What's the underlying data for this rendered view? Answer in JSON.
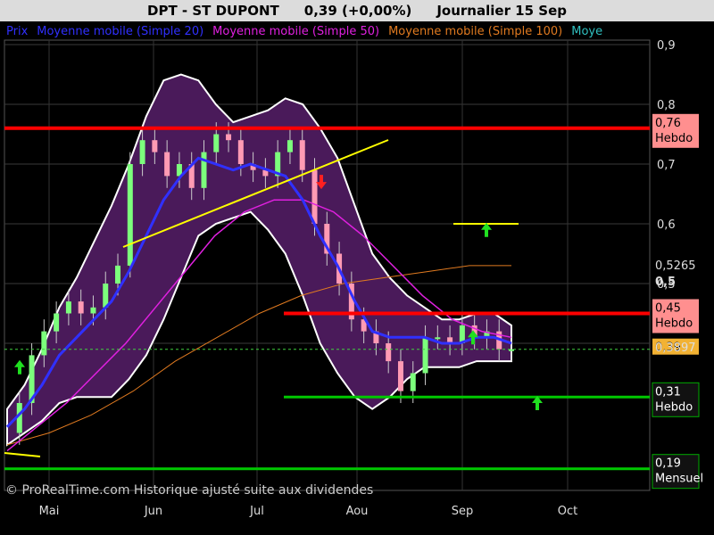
{
  "header": {
    "symbol": "DPT - ST DUPONT",
    "price_change": "0,39 (+0,00%)",
    "period": "Journalier  15 Sep"
  },
  "legend": [
    {
      "label": "Prix",
      "color": "#3030ff"
    },
    {
      "label": "Moyenne mobile (Simple 20)",
      "color": "#3030ff"
    },
    {
      "label": "Moyenne mobile (Simple 50)",
      "color": "#e020e0"
    },
    {
      "label": "Moyenne mobile (Simple 100)",
      "color": "#e07a20"
    },
    {
      "label": "Moye",
      "color": "#30c0c0"
    }
  ],
  "footer": "© ProRealTime.com Historique ajusté suite aux dividendes",
  "colors": {
    "background": "#000000",
    "bollinger_fill": "#4a1a5a",
    "candle_up": "#7cff7c",
    "candle_down": "#ff9ab4",
    "level_red": "#ff0000",
    "level_green": "#00c800",
    "trendline": "#ffff00"
  },
  "chart_data": {
    "type": "candlestick",
    "x_ticks": [
      "Mai",
      "Jun",
      "Jul",
      "Aou",
      "Sep",
      "Oct"
    ],
    "y_ticks": [
      0.4,
      0.5,
      0.6,
      0.7,
      0.8,
      0.9
    ],
    "y_tick_labels": [
      "0,4",
      "0,5",
      "0,6",
      "0,7",
      "0,8",
      "0,9"
    ],
    "ylim": [
      0.18,
      0.92
    ],
    "grid": true,
    "close_series": [
      0.25,
      0.3,
      0.38,
      0.42,
      0.45,
      0.47,
      0.45,
      0.46,
      0.5,
      0.53,
      0.7,
      0.74,
      0.72,
      0.68,
      0.7,
      0.66,
      0.72,
      0.75,
      0.74,
      0.7,
      0.69,
      0.68,
      0.72,
      0.74,
      0.69,
      0.6,
      0.55,
      0.5,
      0.44,
      0.42,
      0.4,
      0.37,
      0.32,
      0.35,
      0.41,
      0.41,
      0.4,
      0.43,
      0.41,
      0.42,
      0.39,
      0.39
    ],
    "sma20_series": [
      0.26,
      0.29,
      0.33,
      0.38,
      0.41,
      0.44,
      0.47,
      0.52,
      0.58,
      0.64,
      0.68,
      0.71,
      0.7,
      0.69,
      0.7,
      0.69,
      0.68,
      0.64,
      0.58,
      0.53,
      0.47,
      0.42,
      0.41,
      0.41,
      0.41,
      0.4,
      0.4,
      0.41,
      0.41,
      0.4
    ],
    "sma50_series": [
      0.22,
      0.26,
      0.3,
      0.35,
      0.4,
      0.46,
      0.52,
      0.58,
      0.62,
      0.64,
      0.64,
      0.62,
      0.58,
      0.53,
      0.48,
      0.44,
      0.42,
      0.41
    ],
    "sma100_series": [
      0.23,
      0.25,
      0.28,
      0.32,
      0.37,
      0.41,
      0.45,
      0.48,
      0.5,
      0.51,
      0.52,
      0.53,
      0.53
    ],
    "levels": [
      {
        "value": 0.76,
        "label": "0,76",
        "tag": "Hebdo",
        "color": "red"
      },
      {
        "value": 0.45,
        "label": "0,45",
        "tag": "Hebdo",
        "color": "red"
      },
      {
        "value": 0.31,
        "label": "0,31",
        "tag": "Hebdo",
        "color": "green"
      },
      {
        "value": 0.19,
        "label": "0,19",
        "tag": "Mensuel",
        "color": "green"
      }
    ],
    "side_values": [
      {
        "value": 0.5265,
        "label": "0,5265"
      },
      {
        "value": 0.5,
        "label": "0,5"
      },
      {
        "value": 0.39,
        "label": "0,39"
      },
      {
        "value": 0.3897,
        "label": "0,3897"
      }
    ],
    "arrows": [
      {
        "date_index": 0,
        "direction": "up",
        "color": "green"
      },
      {
        "date_index": 1,
        "direction": "down",
        "color": "red"
      },
      {
        "date_index": 2,
        "direction": "up",
        "color": "green"
      },
      {
        "date_index": 3,
        "direction": "up",
        "color": "green"
      },
      {
        "date_index": 4,
        "direction": "up",
        "color": "green"
      }
    ]
  }
}
